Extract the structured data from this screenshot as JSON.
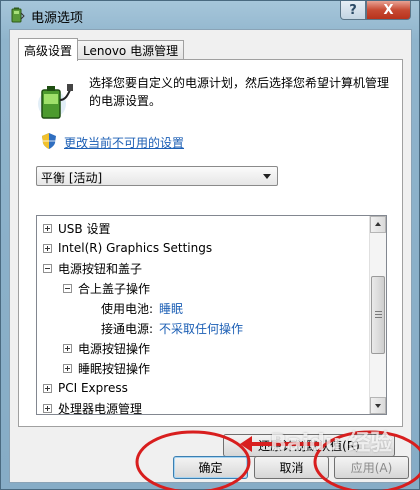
{
  "window": {
    "title": "电源选项",
    "help_label": "?",
    "close_label": "X"
  },
  "tabs": [
    {
      "label": "高级设置",
      "active": true
    },
    {
      "label": "Lenovo 电源管理",
      "active": false
    }
  ],
  "intro": {
    "text": "选择您要自定义的电源计划，然后选择您希望计算机管理的电源设置。"
  },
  "change_link": "更改当前不可用的设置",
  "plan_select": {
    "value": "平衡 [活动]"
  },
  "tree": [
    {
      "label": "USB 设置",
      "expander": "plus",
      "value": ""
    },
    {
      "label": "Intel(R) Graphics Settings",
      "expander": "plus",
      "value": ""
    },
    {
      "label": "电源按钮和盖子",
      "expander": "minus",
      "value": ""
    },
    {
      "label": "合上盖子操作",
      "expander": "minus",
      "value": ""
    },
    {
      "label": "使用电池:",
      "expander": "",
      "value": "睡眠"
    },
    {
      "label": "接通电源:",
      "expander": "",
      "value": "不采取任何操作"
    },
    {
      "label": "电源按钮操作",
      "expander": "plus",
      "value": ""
    },
    {
      "label": "睡眠按钮操作",
      "expander": "plus",
      "value": ""
    },
    {
      "label": "PCI Express",
      "expander": "plus",
      "value": ""
    },
    {
      "label": "处理器电源管理",
      "expander": "plus",
      "value": ""
    }
  ],
  "buttons": {
    "restore": "还原计划默认值(R)",
    "ok": "确定",
    "cancel": "取消",
    "apply": "应用(A)"
  },
  "watermark": "Baidu 经验",
  "colors": {
    "link": "#1c5fb5",
    "annotation_red": "#d81e1e",
    "title_bar": "#a6c6da"
  }
}
